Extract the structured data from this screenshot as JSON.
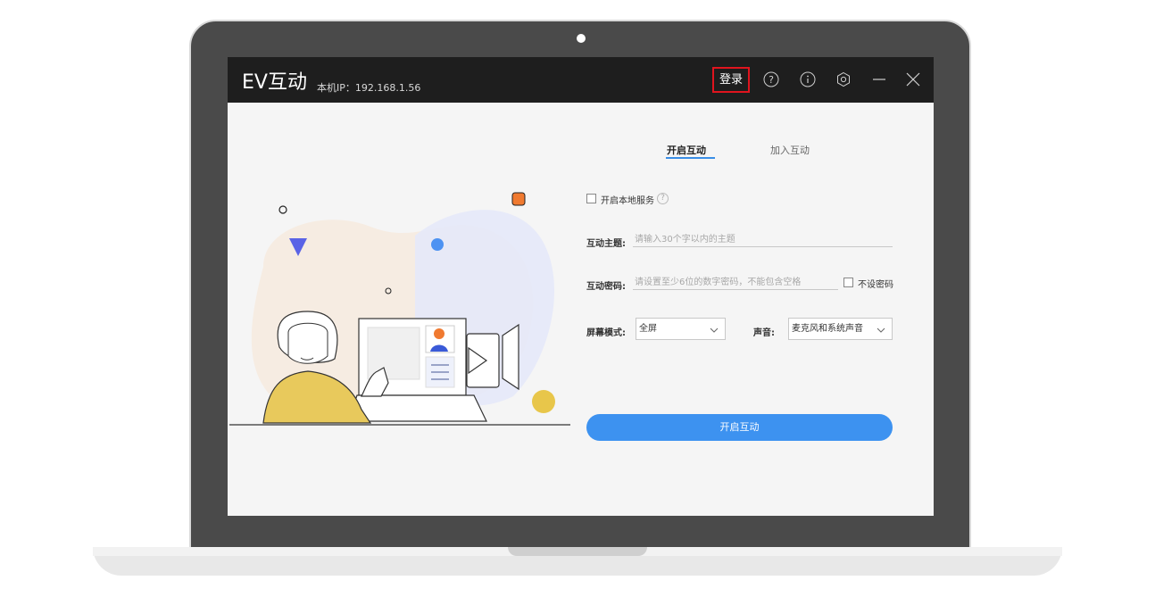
{
  "app": {
    "title": "EV互动",
    "ip_label": "本机IP：192.168.1.56"
  },
  "titlebar": {
    "login_label": "登录",
    "icons": [
      "help-icon",
      "info-icon",
      "settings-icon",
      "minimize-icon",
      "close-icon"
    ]
  },
  "tabs": {
    "start": "开启互动",
    "join": "加入互动"
  },
  "form": {
    "local_service_label": "开启本地服务",
    "local_service_checked": false,
    "help_glyph": "?",
    "topic_label": "互动主题:",
    "topic_placeholder": "请输入30个字以内的主题",
    "password_label": "互动密码:",
    "password_placeholder": "请设置至少6位的数字密码，不能包含空格",
    "no_password_label": "不设密码",
    "no_password_checked": false,
    "screen_mode_label": "屏幕模式:",
    "screen_mode_value": "全屏",
    "sound_label": "声音:",
    "sound_value": "麦克风和系统声音",
    "submit_label": "开启互动"
  },
  "colors": {
    "accent": "#3d92f0",
    "titlebar": "#1e1e1e",
    "highlight_border": "#e0141e"
  }
}
